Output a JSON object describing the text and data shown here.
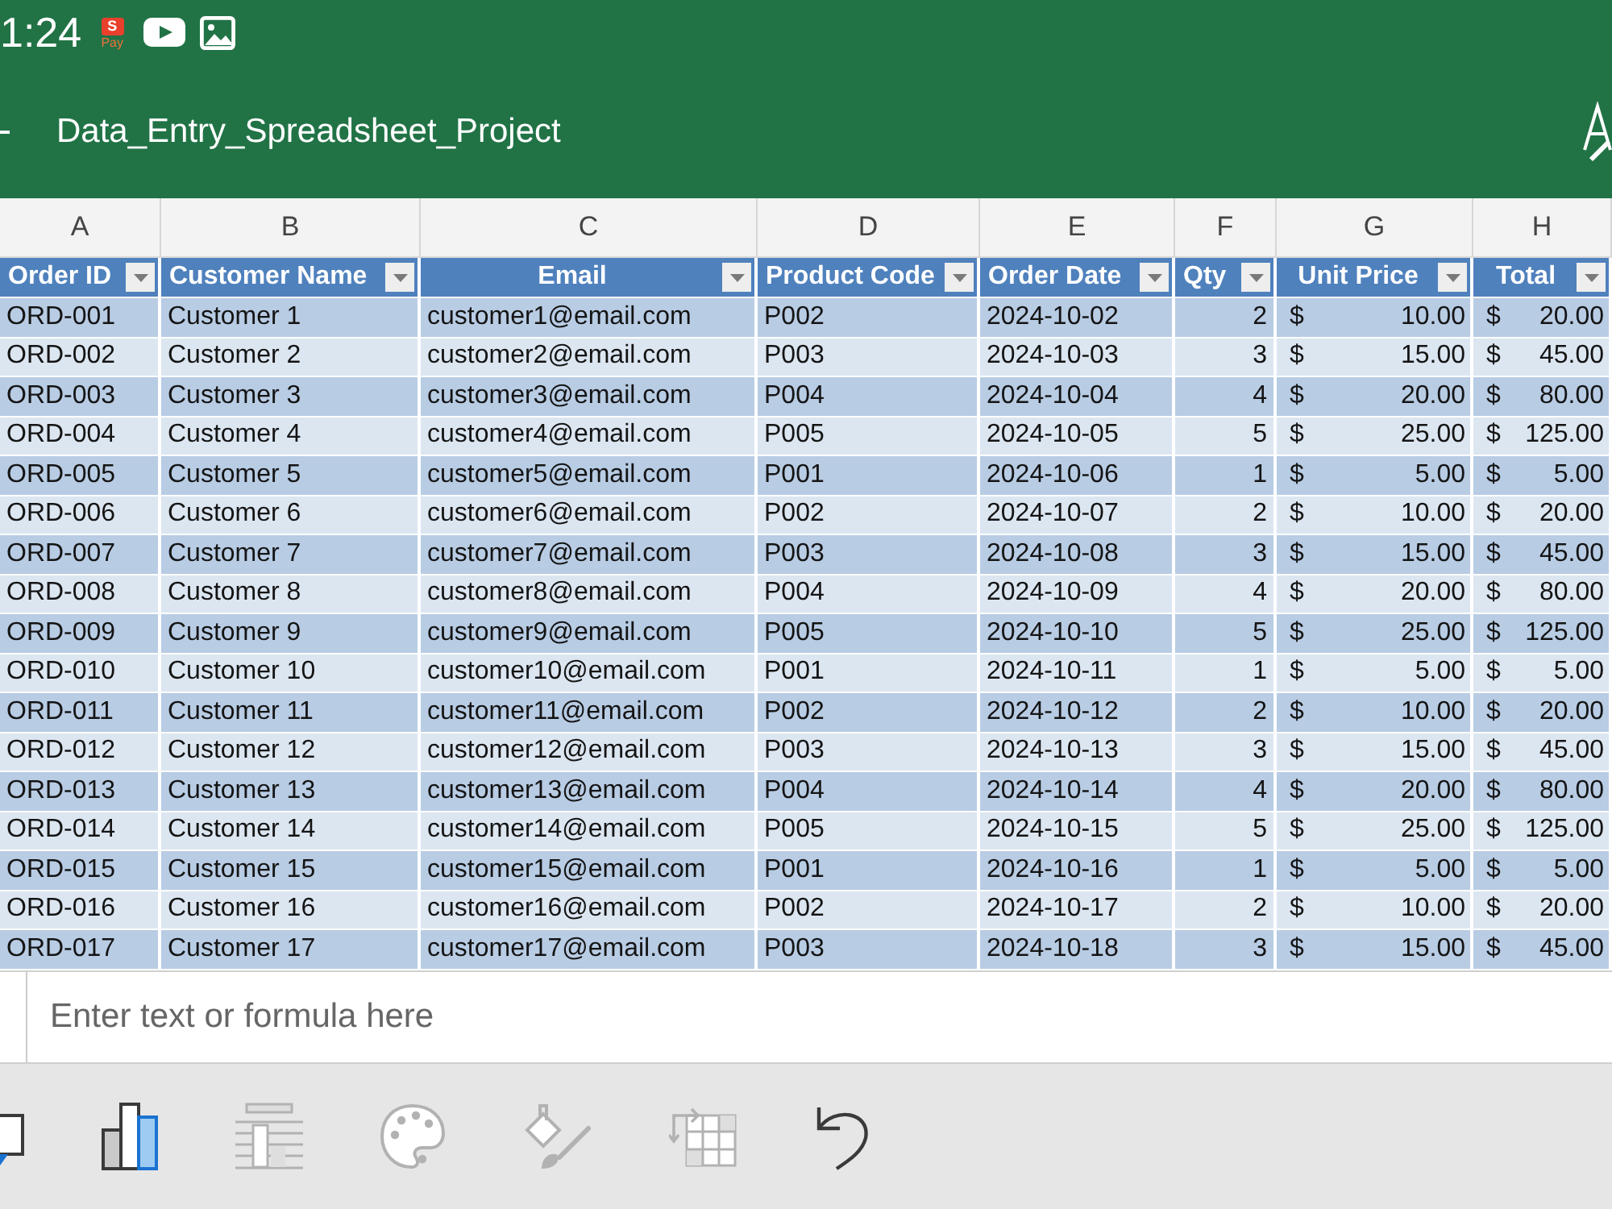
{
  "status_bar": {
    "time": "1:24",
    "notifications": [
      {
        "kind": "pay",
        "mark": "S",
        "caption": "Pay"
      },
      {
        "kind": "video"
      },
      {
        "kind": "image"
      }
    ]
  },
  "app_bar": {
    "title": "Data_Entry_Spreadsheet_Project"
  },
  "sheet": {
    "column_letters": [
      "A",
      "B",
      "C",
      "D",
      "E",
      "F",
      "G",
      "H"
    ],
    "headers": [
      {
        "label": "Order ID",
        "kind": "text",
        "centered": false
      },
      {
        "label": "Customer Name",
        "kind": "text",
        "centered": false
      },
      {
        "label": "Email",
        "kind": "text",
        "centered": true
      },
      {
        "label": "Product Code",
        "kind": "text",
        "centered": false
      },
      {
        "label": "Order Date",
        "kind": "text",
        "centered": false
      },
      {
        "label": "Qty",
        "kind": "number",
        "centered": false
      },
      {
        "label": "Unit Price",
        "kind": "currency",
        "centered": true
      },
      {
        "label": "Total",
        "kind": "currency",
        "centered": true
      }
    ],
    "rows": [
      [
        "ORD-001",
        "Customer 1",
        "customer1@email.com",
        "P002",
        "2024-10-02",
        "2",
        {
          "symbol": "$",
          "amount": "10.00"
        },
        {
          "symbol": "$",
          "amount": "20.00"
        }
      ],
      [
        "ORD-002",
        "Customer 2",
        "customer2@email.com",
        "P003",
        "2024-10-03",
        "3",
        {
          "symbol": "$",
          "amount": "15.00"
        },
        {
          "symbol": "$",
          "amount": "45.00"
        }
      ],
      [
        "ORD-003",
        "Customer 3",
        "customer3@email.com",
        "P004",
        "2024-10-04",
        "4",
        {
          "symbol": "$",
          "amount": "20.00"
        },
        {
          "symbol": "$",
          "amount": "80.00"
        }
      ],
      [
        "ORD-004",
        "Customer 4",
        "customer4@email.com",
        "P005",
        "2024-10-05",
        "5",
        {
          "symbol": "$",
          "amount": "25.00"
        },
        {
          "symbol": "$",
          "amount": "125.00"
        }
      ],
      [
        "ORD-005",
        "Customer 5",
        "customer5@email.com",
        "P001",
        "2024-10-06",
        "1",
        {
          "symbol": "$",
          "amount": "5.00"
        },
        {
          "symbol": "$",
          "amount": "5.00"
        }
      ],
      [
        "ORD-006",
        "Customer 6",
        "customer6@email.com",
        "P002",
        "2024-10-07",
        "2",
        {
          "symbol": "$",
          "amount": "10.00"
        },
        {
          "symbol": "$",
          "amount": "20.00"
        }
      ],
      [
        "ORD-007",
        "Customer 7",
        "customer7@email.com",
        "P003",
        "2024-10-08",
        "3",
        {
          "symbol": "$",
          "amount": "15.00"
        },
        {
          "symbol": "$",
          "amount": "45.00"
        }
      ],
      [
        "ORD-008",
        "Customer 8",
        "customer8@email.com",
        "P004",
        "2024-10-09",
        "4",
        {
          "symbol": "$",
          "amount": "20.00"
        },
        {
          "symbol": "$",
          "amount": "80.00"
        }
      ],
      [
        "ORD-009",
        "Customer 9",
        "customer9@email.com",
        "P005",
        "2024-10-10",
        "5",
        {
          "symbol": "$",
          "amount": "25.00"
        },
        {
          "symbol": "$",
          "amount": "125.00"
        }
      ],
      [
        "ORD-010",
        "Customer 10",
        "customer10@email.com",
        "P001",
        "2024-10-11",
        "1",
        {
          "symbol": "$",
          "amount": "5.00"
        },
        {
          "symbol": "$",
          "amount": "5.00"
        }
      ],
      [
        "ORD-011",
        "Customer 11",
        "customer11@email.com",
        "P002",
        "2024-10-12",
        "2",
        {
          "symbol": "$",
          "amount": "10.00"
        },
        {
          "symbol": "$",
          "amount": "20.00"
        }
      ],
      [
        "ORD-012",
        "Customer 12",
        "customer12@email.com",
        "P003",
        "2024-10-13",
        "3",
        {
          "symbol": "$",
          "amount": "15.00"
        },
        {
          "symbol": "$",
          "amount": "45.00"
        }
      ],
      [
        "ORD-013",
        "Customer 13",
        "customer13@email.com",
        "P004",
        "2024-10-14",
        "4",
        {
          "symbol": "$",
          "amount": "20.00"
        },
        {
          "symbol": "$",
          "amount": "80.00"
        }
      ],
      [
        "ORD-014",
        "Customer 14",
        "customer14@email.com",
        "P005",
        "2024-10-15",
        "5",
        {
          "symbol": "$",
          "amount": "25.00"
        },
        {
          "symbol": "$",
          "amount": "125.00"
        }
      ],
      [
        "ORD-015",
        "Customer 15",
        "customer15@email.com",
        "P001",
        "2024-10-16",
        "1",
        {
          "symbol": "$",
          "amount": "5.00"
        },
        {
          "symbol": "$",
          "amount": "5.00"
        }
      ],
      [
        "ORD-016",
        "Customer 16",
        "customer16@email.com",
        "P002",
        "2024-10-17",
        "2",
        {
          "symbol": "$",
          "amount": "10.00"
        },
        {
          "symbol": "$",
          "amount": "20.00"
        }
      ],
      [
        "ORD-017",
        "Customer 17",
        "customer17@email.com",
        "P003",
        "2024-10-18",
        "3",
        {
          "symbol": "$",
          "amount": "15.00"
        },
        {
          "symbol": "$",
          "amount": "45.00"
        }
      ]
    ]
  },
  "formula_bar": {
    "placeholder": "Enter text or formula here"
  },
  "toolbar": [
    {
      "kind": "comment",
      "disabled": false
    },
    {
      "kind": "chart",
      "disabled": false
    },
    {
      "kind": "table_style",
      "disabled": true
    },
    {
      "kind": "palette",
      "disabled": true
    },
    {
      "kind": "format_painter",
      "disabled": true
    },
    {
      "kind": "transpose",
      "disabled": true
    },
    {
      "kind": "undo",
      "disabled": false
    }
  ]
}
